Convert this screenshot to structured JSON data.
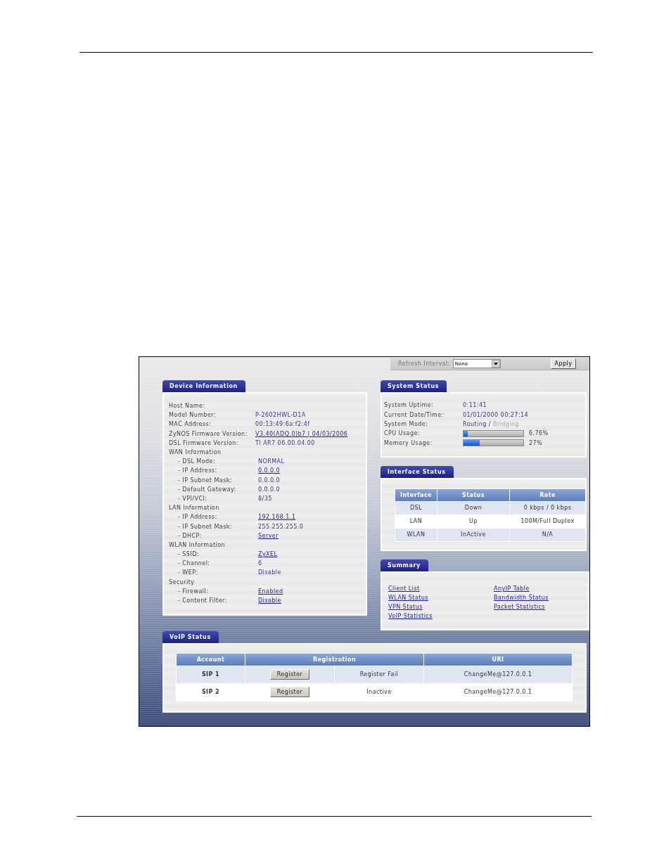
{
  "toolbar": {
    "label": "Refresh Interval:",
    "interval": "None",
    "button": "Apply"
  },
  "device_information": {
    "title": "Device Information",
    "rows": [
      {
        "kind": "field",
        "label": "Host Name:"
      },
      {
        "kind": "field",
        "label": "Model Number:",
        "value": "P-2602HWL-D1A",
        "link": false
      },
      {
        "kind": "field",
        "label": "MAC Address:",
        "value": "00:13:49:6a:f2:4f",
        "link": false
      },
      {
        "kind": "field",
        "label": "ZyNOS Firmware Version:",
        "value": "V3.40(ADQ.0)b7 | 04/03/2006",
        "link": true
      },
      {
        "kind": "field",
        "label": "DSL Firmware Version:",
        "value": "TI AR7 06.00.04.00",
        "link": false
      },
      {
        "kind": "section",
        "label": "WAN Information"
      },
      {
        "kind": "subfield",
        "label": "- DSL Mode:",
        "value": "NORMAL",
        "link": false
      },
      {
        "kind": "subfield",
        "label": "- IP Address:",
        "value": "0.0.0.0",
        "link": true
      },
      {
        "kind": "subfield",
        "label": "- IP Subnet Mask:",
        "value": "0.0.0.0",
        "link": false
      },
      {
        "kind": "subfield",
        "label": "- Default Gateway:",
        "value": "0.0.0.0",
        "link": false
      },
      {
        "kind": "subfield",
        "label": "- VPI/VCI:",
        "value": "8/35",
        "link": false
      },
      {
        "kind": "section",
        "label": "LAN Information"
      },
      {
        "kind": "subfield",
        "label": "- IP Address:",
        "value": "192.168.1.1",
        "link": true
      },
      {
        "kind": "subfield",
        "label": "- IP Subnet Mask:",
        "value": "255.255.255.0",
        "link": false
      },
      {
        "kind": "subfield",
        "label": "- DHCP:",
        "value": "Server",
        "link": true
      },
      {
        "kind": "section",
        "label": "WLAN Information"
      },
      {
        "kind": "subfield",
        "label": "- SSID:",
        "value": "ZyXEL",
        "link": true
      },
      {
        "kind": "subfield",
        "label": "- Channel:",
        "value": "6",
        "link": false
      },
      {
        "kind": "subfield",
        "label": "- WEP:",
        "value": "Disable",
        "link": false
      },
      {
        "kind": "section",
        "label": "Security"
      },
      {
        "kind": "subfield",
        "label": "- Firewall:",
        "value": "Enabled",
        "link": true
      },
      {
        "kind": "subfield",
        "label": "- Content Filter:",
        "value": "Disable",
        "link": true
      }
    ]
  },
  "system_status": {
    "title": "System Status",
    "rows": [
      {
        "kind": "text",
        "label": "System Uptime:",
        "value": "0:11:41"
      },
      {
        "kind": "text",
        "label": "Current Date/Time:",
        "value": "01/01/2000 00:27:14"
      },
      {
        "kind": "mode",
        "label": "System Mode:",
        "options": [
          {
            "label": "Routing",
            "selected": true
          },
          {
            "label": "Bridging",
            "selected": false
          }
        ],
        "separator": "/"
      },
      {
        "kind": "meter",
        "label": "CPU Usage:",
        "level": 0.0676,
        "reading": "6.76%"
      },
      {
        "kind": "meter",
        "label": "Memory Usage:",
        "level": 0.27,
        "reading": "27%"
      }
    ]
  },
  "interface_status": {
    "title": "Interface Status",
    "columns": [
      "Interface",
      "Status",
      "Rate"
    ],
    "rows": [
      [
        "DSL",
        "Down",
        "0 kbps / 0 kbps"
      ],
      [
        "LAN",
        "Up",
        "100M/Full Duplex"
      ],
      [
        "WLAN",
        "InActive",
        "N/A"
      ]
    ]
  },
  "summary": {
    "title": "Summary",
    "columns": [
      [
        "Client List",
        "WLAN Status",
        "VPN Status",
        "VoIP Statistics"
      ],
      [
        "AnyIP Table",
        "Bandwidth Status",
        "Packet Statistics"
      ]
    ]
  },
  "voip_status": {
    "title": "VoIP Status",
    "columns": [
      "Account",
      "Registration",
      "URI"
    ],
    "rows": [
      {
        "account": "SIP 1",
        "button": "Register",
        "registration": "Register Fail",
        "uri": "ChangeMe@127.0.0.1"
      },
      {
        "account": "SIP 2",
        "button": "Register",
        "registration": "Inactive",
        "uri": "ChangeMe@127.0.0.1"
      }
    ]
  }
}
